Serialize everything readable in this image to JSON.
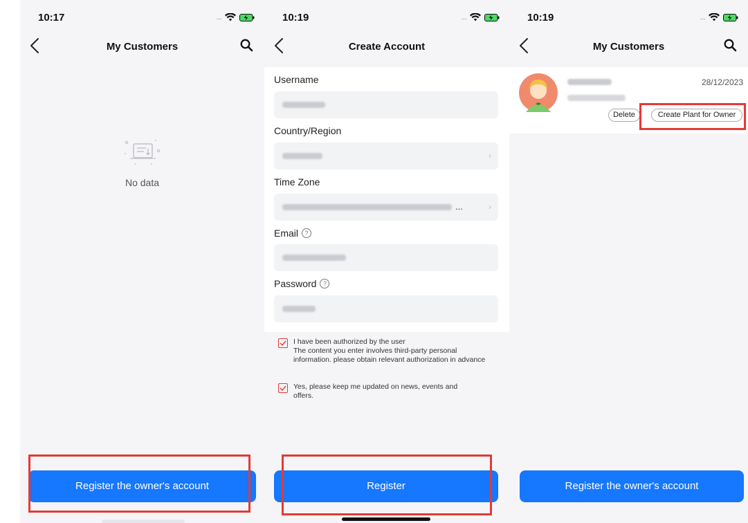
{
  "status_bar": {
    "times": [
      "10:17",
      "10:19",
      "10:19"
    ],
    "signal_dots": ".....",
    "wifi_icon": "wifi-icon",
    "battery_icon": "battery-charging-icon"
  },
  "screen1": {
    "nav_title": "My Customers",
    "empty_icon": "empty-box-icon",
    "empty_text": "No data",
    "button_label": "Register the owner's account"
  },
  "screen2": {
    "nav_title": "Create Account",
    "fields": [
      {
        "label": "Username"
      },
      {
        "label": "Country/Region"
      },
      {
        "label": "Time Zone"
      },
      {
        "label": "Email"
      },
      {
        "label": "Password"
      }
    ],
    "help_glyph": "?",
    "chevron_glyph": "›",
    "timezone_ellipsis": "...",
    "consent1": "I have been authorized by the user\nThe content you enter involves third-party personal information. please obtain relevant authorization in advance",
    "consent2": "Yes, please keep me updated on news, events and offers.",
    "button_label": "Register"
  },
  "screen3": {
    "nav_title": "My Customers",
    "customer": {
      "date": "28/12/2023",
      "delete_label": "Delete",
      "create_plant_label": "Create Plant for Owner"
    },
    "button_label": "Register the owner's account"
  },
  "colors": {
    "accent": "#1677ff",
    "highlight": "#e53935",
    "background": "#f5f5f7"
  }
}
